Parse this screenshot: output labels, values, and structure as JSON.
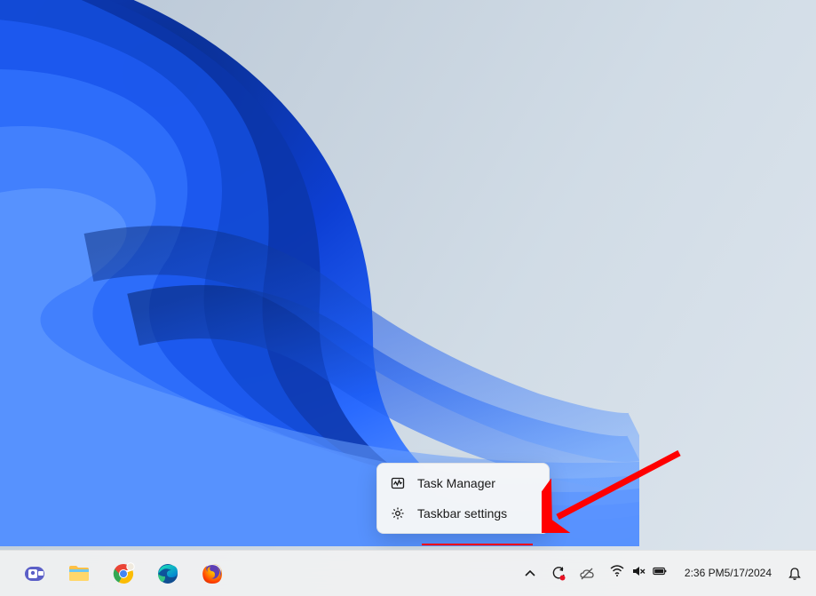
{
  "context_menu": {
    "items": [
      {
        "icon": "task-manager-icon",
        "label": "Task Manager"
      },
      {
        "icon": "gear-icon",
        "label": "Taskbar settings"
      }
    ],
    "highlighted_index": 1
  },
  "taskbar": {
    "apps": [
      {
        "name": "teams",
        "label": "Microsoft Teams"
      },
      {
        "name": "explorer",
        "label": "File Explorer"
      },
      {
        "name": "chrome",
        "label": "Google Chrome"
      },
      {
        "name": "edge",
        "label": "Microsoft Edge"
      },
      {
        "name": "firefox",
        "label": "Firefox"
      }
    ]
  },
  "system_tray": {
    "overflow": "^",
    "windows_update_alert": true,
    "onedrive": "paused",
    "wifi": "connected",
    "volume": "muted",
    "battery": "on",
    "time": "2:36 PM",
    "date": "5/17/2024",
    "notifications": "none"
  },
  "annotation": {
    "type": "arrow",
    "target": "context_menu.items.1"
  }
}
